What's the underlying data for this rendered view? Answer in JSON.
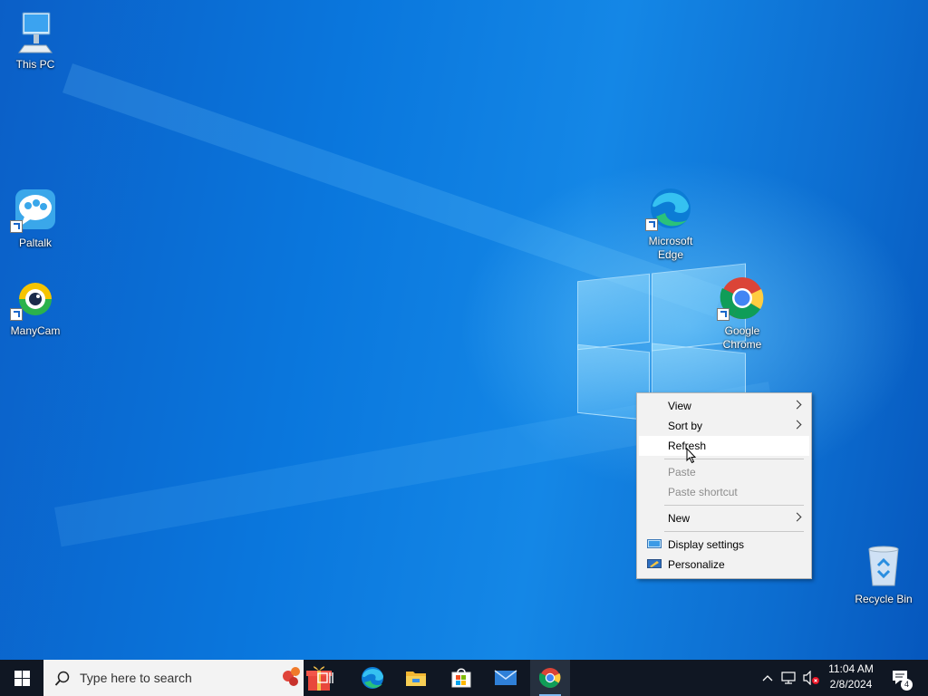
{
  "desktop": {
    "icons": [
      {
        "label": "This PC"
      },
      {
        "label": "Paltalk"
      },
      {
        "label": "ManyCam"
      },
      {
        "label": "Microsoft Edge"
      },
      {
        "label": "Google Chrome"
      },
      {
        "label": "Recycle Bin"
      }
    ]
  },
  "context_menu": {
    "items": [
      {
        "label": "View",
        "submenu": true
      },
      {
        "label": "Sort by",
        "submenu": true
      },
      {
        "label": "Refresh",
        "highlighted": true
      },
      {
        "label": "Paste",
        "disabled": true
      },
      {
        "label": "Paste shortcut",
        "disabled": true
      },
      {
        "label": "New",
        "submenu": true
      },
      {
        "label": "Display settings",
        "icon": "display-settings-icon"
      },
      {
        "label": "Personalize",
        "icon": "personalize-icon"
      }
    ]
  },
  "taskbar": {
    "search_placeholder": "Type here to search",
    "apps": [
      "task-view-icon",
      "edge-icon",
      "file-explorer-icon",
      "store-icon",
      "mail-icon",
      "chrome-icon"
    ],
    "time": "11:04 AM",
    "date": "2/8/2024",
    "notification_count": "4"
  },
  "colors": {
    "taskbar": "#101723",
    "desktop": "#0a77dd",
    "menu_bg": "#f2f2f2"
  }
}
